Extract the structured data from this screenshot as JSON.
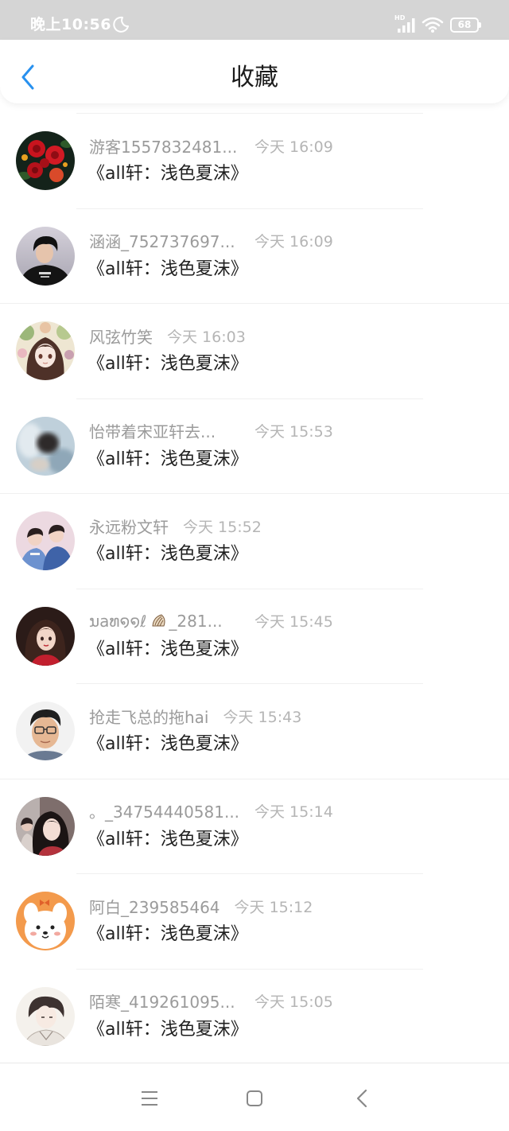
{
  "status_bar": {
    "time": "晚上10:56",
    "network_label": "HD",
    "battery_level": "68",
    "icons": {
      "dnd": "moon-icon",
      "signal": "signal-icon",
      "wifi": "wifi-icon",
      "battery": "battery-icon"
    }
  },
  "header": {
    "title": "收藏",
    "back_icon": "chevron-left-icon"
  },
  "list": {
    "items": [
      {
        "name": "游客1557832481...",
        "time": "今天 16:09",
        "title": "《all轩：浅色夏沫》"
      },
      {
        "name": "涵涵_752737697...",
        "time": "今天 16:09",
        "title": "《all轩：浅色夏沫》"
      },
      {
        "name": "风弦竹笑",
        "time": "今天 16:03",
        "title": "《all轩：浅色夏沫》"
      },
      {
        "name": "怡带着宋亚轩去...",
        "time": "今天 15:53",
        "title": "《all轩：浅色夏沫》"
      },
      {
        "name": "永远粉文轩",
        "time": "今天 15:52",
        "title": "《all轩：浅色夏沫》"
      },
      {
        "name": "ນaທ໑໑ℓ",
        "name_icon": "shell-icon",
        "name_suffix": "_281...",
        "time": "今天 15:45",
        "title": "《all轩：浅色夏沫》"
      },
      {
        "name": "抢走飞总的拖hai",
        "time": "今天 15:43",
        "title": "《all轩：浅色夏沫》"
      },
      {
        "name": "。_34754440581...",
        "time": "今天 15:14",
        "title": "《all轩：浅色夏沫》"
      },
      {
        "name": "阿白_239585464",
        "time": "今天 15:12",
        "title": "《all轩：浅色夏沫》"
      },
      {
        "name": "陌寒_419261095...",
        "time": "今天 15:05",
        "title": "《all轩：浅色夏沫》"
      }
    ]
  },
  "nav_bar": {
    "icons": {
      "recents": "menu-icon",
      "home": "square-icon",
      "back": "back-arrow-icon"
    }
  },
  "colors": {
    "accent": "#2891ef",
    "status_bar_bg": "#d5d5d5",
    "name_text": "#9b9b9b",
    "time_text": "#b5b5b5",
    "title_text": "#1f1f1f"
  }
}
